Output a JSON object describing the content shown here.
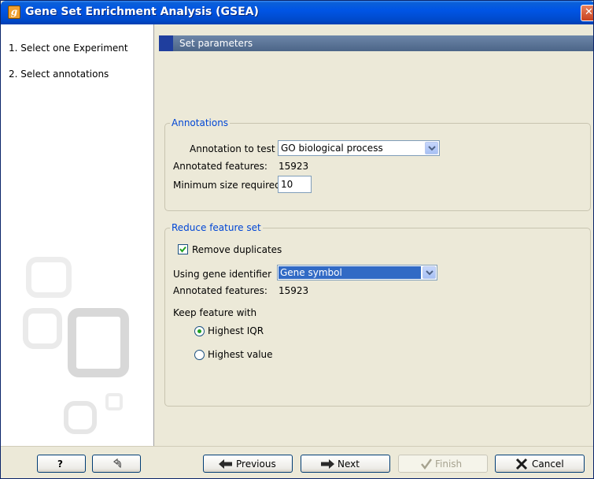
{
  "window": {
    "title": "Gene Set Enrichment Analysis (GSEA)",
    "app_icon_glyph": "g",
    "close_glyph": "✕"
  },
  "sidebar": {
    "steps": [
      {
        "label": "1.  Select one Experiment"
      },
      {
        "label": "2.  Select annotations"
      }
    ]
  },
  "main": {
    "section_title": "Set parameters",
    "annotations": {
      "title": "Annotations",
      "annotation_to_test_label": "Annotation to test",
      "annotation_to_test_value": "GO biological process",
      "annotated_features_label": "Annotated features:",
      "annotated_features_value": "15923",
      "min_size_label": "Minimum size required",
      "min_size_value": "10"
    },
    "reduce": {
      "title": "Reduce feature set",
      "remove_duplicates_label": "Remove duplicates",
      "remove_duplicates_checked": true,
      "gene_identifier_label": "Using gene identifier",
      "gene_identifier_value": "Gene symbol",
      "annotated_features_label": "Annotated features:",
      "annotated_features_value": "15923",
      "keep_feature_label": "Keep feature with",
      "options": [
        {
          "label": "Highest IQR",
          "selected": true
        },
        {
          "label": "Highest value",
          "selected": false
        }
      ]
    }
  },
  "buttons": {
    "help": "?",
    "previous": "Previous",
    "next": "Next",
    "finish": "Finish",
    "cancel": "Cancel"
  },
  "colors": {
    "title_bar": "#0055e5",
    "group_title": "#0046d5",
    "selection": "#316ac5",
    "radio_dot": "#21a121"
  }
}
